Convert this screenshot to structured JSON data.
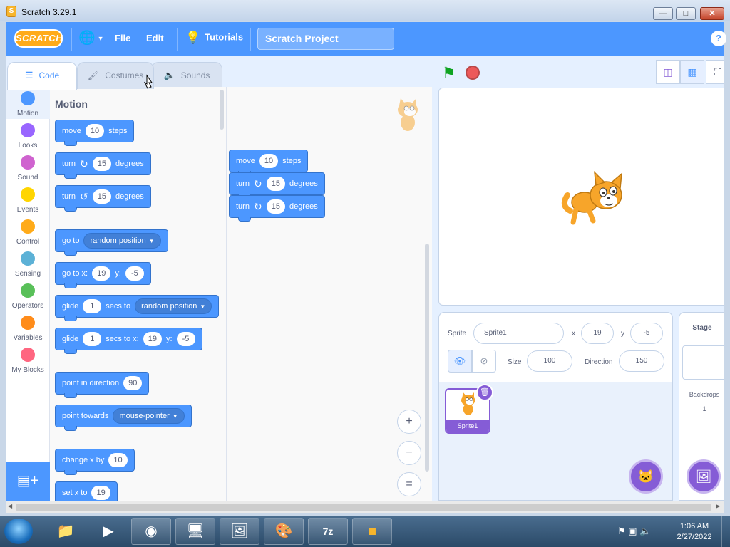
{
  "window": {
    "title": "Scratch 3.29.1",
    "min": "—",
    "max": "□",
    "close": "✕"
  },
  "menubar": {
    "logo": "SCRATCH",
    "file": "File",
    "edit": "Edit",
    "tutorials": "Tutorials",
    "project_title": "Scratch Project",
    "help": "?"
  },
  "tabs": [
    {
      "label": "Code",
      "icon": "code-icon",
      "active": true
    },
    {
      "label": "Costumes",
      "icon": "brush-icon",
      "active": false
    },
    {
      "label": "Sounds",
      "icon": "speaker-icon",
      "active": false
    }
  ],
  "categories": [
    {
      "label": "Motion",
      "color": "#4c97ff"
    },
    {
      "label": "Looks",
      "color": "#9966ff"
    },
    {
      "label": "Sound",
      "color": "#cf63cf"
    },
    {
      "label": "Events",
      "color": "#ffd500"
    },
    {
      "label": "Control",
      "color": "#ffab19"
    },
    {
      "label": "Sensing",
      "color": "#5cb1d6"
    },
    {
      "label": "Operators",
      "color": "#59c059"
    },
    {
      "label": "Variables",
      "color": "#ff8c1a"
    },
    {
      "label": "My Blocks",
      "color": "#ff6680"
    }
  ],
  "palette": {
    "title": "Motion",
    "blocks": {
      "move": {
        "a": "move",
        "n": "10",
        "b": "steps"
      },
      "turn_cw": {
        "a": "turn",
        "n": "15",
        "b": "degrees"
      },
      "turn_ccw": {
        "a": "turn",
        "n": "15",
        "b": "degrees"
      },
      "goto": {
        "a": "go to",
        "dd": "random position"
      },
      "gotoxy": {
        "a": "go to x:",
        "x": "19",
        "b": "y:",
        "y": "-5"
      },
      "glide_to": {
        "a": "glide",
        "n": "1",
        "b": "secs to",
        "dd": "random position"
      },
      "glide_xy": {
        "a": "glide",
        "n": "1",
        "b": "secs to x:",
        "x": "19",
        "c": "y:",
        "y": "-5"
      },
      "point_dir": {
        "a": "point in direction",
        "n": "90"
      },
      "point_towards": {
        "a": "point towards",
        "dd": "mouse-pointer"
      },
      "change_x": {
        "a": "change x by",
        "n": "10"
      },
      "set_x": {
        "a": "set x to",
        "n": "19"
      }
    }
  },
  "script": {
    "move": {
      "a": "move",
      "n": "10",
      "b": "steps"
    },
    "turn1": {
      "a": "turn",
      "n": "15",
      "b": "degrees"
    },
    "turn2": {
      "a": "turn",
      "n": "15",
      "b": "degrees"
    }
  },
  "zoom": {
    "in": "+",
    "out": "−",
    "reset": "="
  },
  "sprite_info": {
    "sprite_label": "Sprite",
    "sprite_name": "Sprite1",
    "x_label": "x",
    "x": "19",
    "y_label": "y",
    "y": "-5",
    "size_label": "Size",
    "size": "100",
    "direction_label": "Direction",
    "direction": "150"
  },
  "sprite_list": [
    {
      "name": "Sprite1",
      "selected": true
    }
  ],
  "stage_pane": {
    "title": "Stage",
    "backdrops_label": "Backdrops",
    "backdrops_count": "1"
  },
  "taskbar": {
    "time": "1:06 AM",
    "date": "2/27/2022"
  }
}
